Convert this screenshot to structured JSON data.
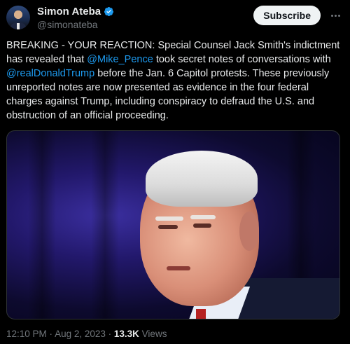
{
  "user": {
    "display_name": "Simon Ateba",
    "handle": "@simonateba",
    "subscribe_label": "Subscribe"
  },
  "tweet": {
    "text_1": "BREAKING - YOUR REACTION: Special Counsel Jack Smith's indictment has revealed that ",
    "mention_1": "@Mike_Pence",
    "text_2": " took secret notes of conversations with ",
    "mention_2": "@realDonaldTrump",
    "text_3": " before the Jan. 6 Capitol protests. These previously unreported notes are now presented as evidence in the four federal charges against Trump, including conspiracy to defraud the U.S. and obstruction of an official proceeding."
  },
  "meta": {
    "time": "12:10 PM",
    "sep1": " · ",
    "date": "Aug 2, 2023",
    "sep2": " · ",
    "views_count": "13.3K",
    "views_label": " Views"
  },
  "colors": {
    "link": "#1d9bf0",
    "verified": "#1d9bf0",
    "background": "#000000"
  },
  "icons": [
    "verified-badge-icon",
    "more-options-icon"
  ]
}
